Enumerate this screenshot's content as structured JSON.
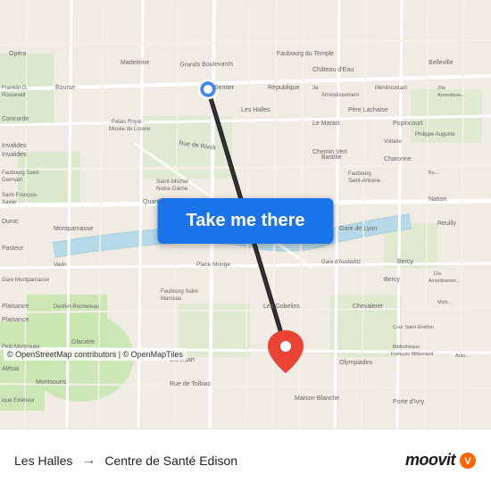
{
  "map": {
    "attribution": "© OpenStreetMap contributors | © OpenMapTiles",
    "center_lat": 48.855,
    "center_lon": 2.345
  },
  "button": {
    "label": "Take me there"
  },
  "route": {
    "from": "Les Halles",
    "to": "Centre de Santé Edison",
    "arrow": "→"
  },
  "branding": {
    "name": "moovit",
    "icon": "●"
  },
  "colors": {
    "button_bg": "#1a73e8",
    "button_text": "#ffffff",
    "route_line": "#1a1a1a",
    "origin_dot": "#4285f4",
    "dest_dot": "#ea4335",
    "road_major": "#ffffff",
    "road_minor": "#f8f4ee",
    "park": "#c8e6b0",
    "water": "#aad3df",
    "building": "#e8e0d8"
  }
}
